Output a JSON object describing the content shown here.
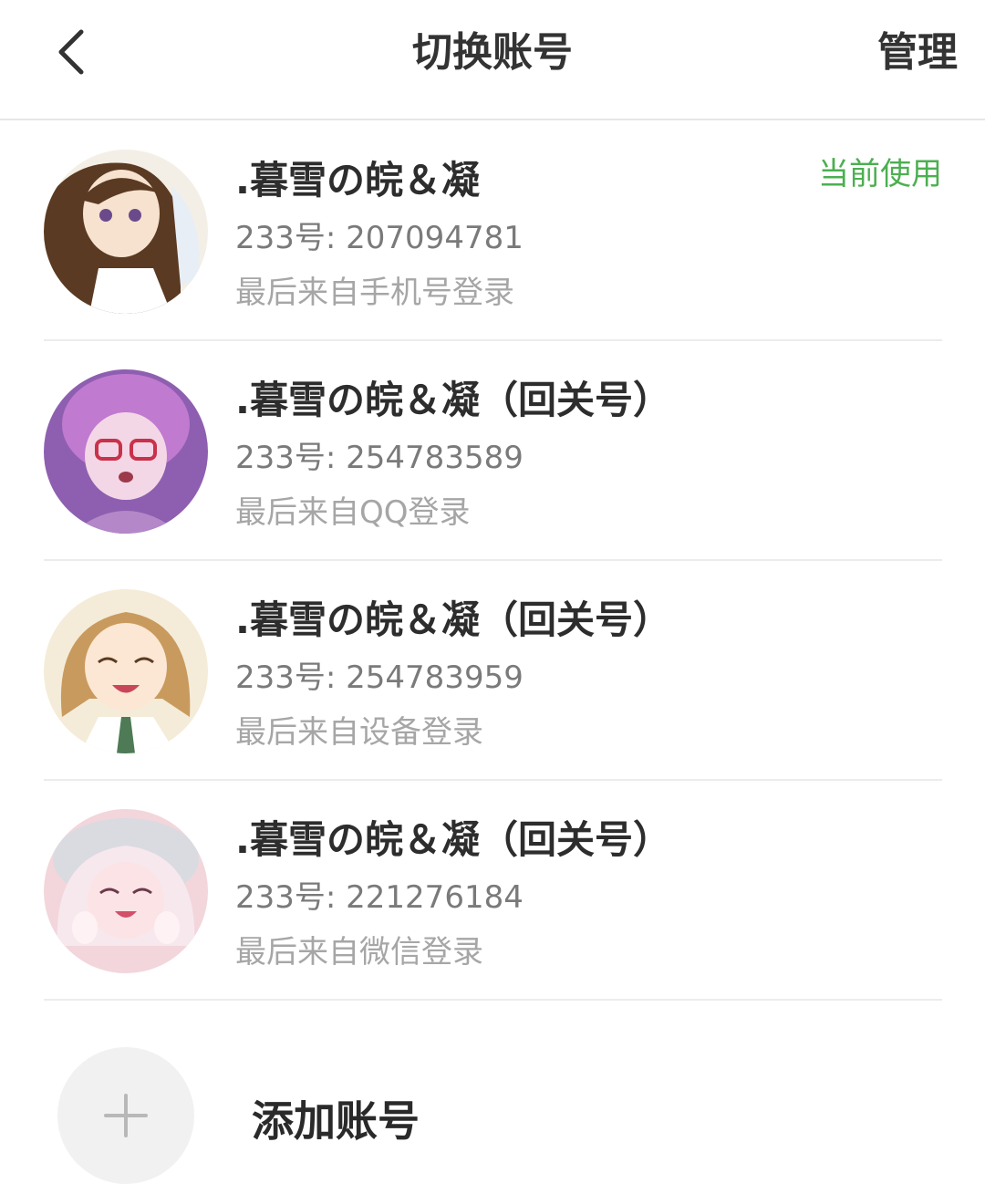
{
  "header": {
    "title": "切换账号",
    "manage_label": "管理",
    "back_icon": "chevron-left-icon"
  },
  "accounts": [
    {
      "name": ".暮雪の皖＆凝",
      "id_text": "233号: 207094781",
      "login_text": "最后来自手机号登录",
      "badge": "当前使用",
      "avatar_colors": [
        "#f4efe6",
        "#5a3a22",
        "#f6e2cf"
      ]
    },
    {
      "name": ".暮雪の皖＆凝（回关号）",
      "id_text": "233号: 254783589",
      "login_text": "最后来自QQ登录",
      "avatar_colors": [
        "#8e5fb0",
        "#c07ad0",
        "#f3d7e6"
      ]
    },
    {
      "name": ".暮雪の皖＆凝（回关号）",
      "id_text": "233号: 254783959",
      "login_text": "最后来自设备登录",
      "avatar_colors": [
        "#f4ecd8",
        "#c99a5e",
        "#fbe7d3"
      ]
    },
    {
      "name": ".暮雪の皖＆凝（回关号）",
      "id_text": "233号: 221276184",
      "login_text": "最后来自微信登录",
      "avatar_colors": [
        "#f2d6dc",
        "#f7e8ee",
        "#fbe3e6"
      ]
    }
  ],
  "add_account": {
    "label": "添加账号",
    "icon": "plus-icon"
  },
  "colors": {
    "accent_green": "#4caf50",
    "divider": "#ececec"
  }
}
